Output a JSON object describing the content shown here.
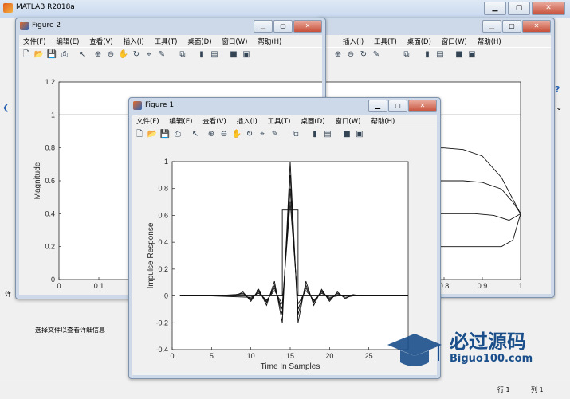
{
  "app": {
    "title": "MATLAB R2018a",
    "left_hint": "选择文件以查看详细信息",
    "left_tab": "详",
    "status_line": "行  1",
    "status_col": "列  1"
  },
  "menu": [
    "文件(F)",
    "编辑(E)",
    "查看(V)",
    "插入(I)",
    "工具(T)",
    "桌面(D)",
    "窗口(W)",
    "帮助(H)"
  ],
  "fig2": {
    "title": "Figure 2"
  },
  "fig1": {
    "title": "Figure 1"
  },
  "fig3_menu_visible": [
    "插入(I)",
    "工具(T)",
    "桌面(D)",
    "窗口(W)",
    "帮助(H)"
  ],
  "watermark": {
    "text": "必过源码",
    "url": "Biguo100.com"
  },
  "chart_data": [
    {
      "type": "line",
      "title": "",
      "xlabel": "",
      "ylabel": "Magnitude",
      "xlim": [
        0,
        1
      ],
      "ylim": [
        0,
        1.2
      ],
      "xticks": [
        "0",
        "0.1",
        "0.2",
        "0.3",
        "0.4"
      ],
      "yticks": [
        "0",
        "0.2",
        "0.4",
        "0.6",
        "0.8",
        "1",
        "1.2"
      ],
      "series": [
        {
          "x": [
            0,
            0.5
          ],
          "y": [
            1,
            1
          ]
        }
      ]
    },
    {
      "type": "line",
      "title": "",
      "xlabel": "Time In Samples",
      "ylabel": "Impulse Response",
      "xlim": [
        0,
        30
      ],
      "ylim": [
        -0.4,
        1
      ],
      "xticks": [
        "0",
        "5",
        "10",
        "15",
        "20",
        "25"
      ],
      "yticks": [
        "-0.4",
        "-0.2",
        "0",
        "0.2",
        "0.4",
        "0.6",
        "0.8",
        "1"
      ],
      "series": [
        {
          "x": [
            1,
            5,
            8,
            9,
            10,
            11,
            12,
            13,
            14,
            15,
            16,
            17,
            18,
            19,
            20,
            21,
            22,
            23,
            24,
            25,
            26,
            27,
            28,
            30
          ],
          "y": [
            0,
            0,
            0,
            0.03,
            -0.04,
            0.05,
            -0.07,
            0.11,
            -0.2,
            1,
            -0.2,
            0.11,
            -0.07,
            0.05,
            -0.04,
            0.03,
            -0.02,
            0.01,
            0,
            0,
            0,
            0,
            0,
            0
          ]
        },
        {
          "x": [
            1,
            5,
            8,
            9,
            10,
            11,
            12,
            13,
            14,
            15,
            16,
            17,
            18,
            19,
            20,
            21,
            22,
            23,
            24,
            25,
            30
          ],
          "y": [
            0,
            0,
            0.01,
            0.02,
            -0.03,
            0.04,
            -0.05,
            0.08,
            -0.14,
            0.9,
            -0.14,
            0.08,
            -0.05,
            0.04,
            -0.03,
            0.02,
            -0.01,
            0,
            0,
            0,
            0
          ]
        },
        {
          "x": [
            1,
            5,
            9,
            10,
            11,
            12,
            13,
            14,
            15,
            16,
            17,
            18,
            19,
            20,
            21,
            22,
            30
          ],
          "y": [
            0,
            0,
            0.01,
            -0.02,
            0.03,
            -0.04,
            0.06,
            -0.1,
            0.8,
            -0.1,
            0.06,
            -0.04,
            0.03,
            -0.02,
            0.01,
            0,
            0
          ]
        },
        {
          "x": [
            1,
            5,
            10,
            11,
            12,
            13,
            14,
            15,
            16,
            17,
            18,
            19,
            20,
            21,
            30
          ],
          "y": [
            0,
            0,
            -0.01,
            0.02,
            -0.03,
            0.04,
            -0.06,
            0.7,
            -0.06,
            0.04,
            -0.03,
            0.02,
            -0.01,
            0,
            0
          ]
        },
        {
          "x": [
            1,
            14,
            14,
            16,
            16,
            30
          ],
          "y": [
            0,
            0,
            0.64,
            0.64,
            0,
            0
          ]
        }
      ]
    },
    {
      "type": "line",
      "title": "",
      "xlabel": "",
      "ylabel": "",
      "xlim": [
        0,
        1
      ],
      "ylim": [
        0,
        1.2
      ],
      "xticks": [
        "0.7",
        "0.8",
        "0.9",
        "1"
      ],
      "series": [
        {
          "x": [
            0.5,
            1
          ],
          "y": [
            1,
            1
          ]
        },
        {
          "x": [
            0.5,
            0.8,
            0.85,
            0.9,
            0.95,
            1
          ],
          "y": [
            0.8,
            0.8,
            0.79,
            0.75,
            0.62,
            0.4
          ]
        },
        {
          "x": [
            0.5,
            0.85,
            0.9,
            0.95,
            0.98,
            1
          ],
          "y": [
            0.6,
            0.6,
            0.59,
            0.55,
            0.47,
            0.4
          ]
        },
        {
          "x": [
            0.5,
            0.88,
            0.93,
            0.97,
            1
          ],
          "y": [
            0.4,
            0.4,
            0.39,
            0.36,
            0.4
          ]
        },
        {
          "x": [
            0.5,
            0.9,
            0.95,
            0.98,
            1
          ],
          "y": [
            0.2,
            0.2,
            0.2,
            0.24,
            0.4
          ]
        }
      ]
    }
  ]
}
